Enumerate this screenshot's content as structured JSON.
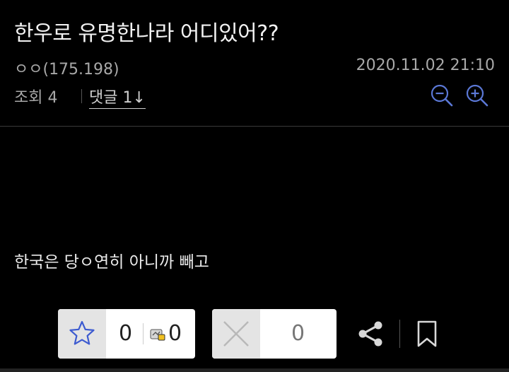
{
  "post": {
    "title": "한우로 유명한나라 어디있어??",
    "author": "ㅇㅇ(175.198)",
    "date": "2020.11.02 21:10",
    "views_label": "조회 4",
    "comments_label": "댓글 1↓",
    "body": "한국은 당ㅇ연히 아니까 빼고"
  },
  "actions": {
    "recommend_count": "0",
    "fixed_recommend_count": "0",
    "dislike_count": "0"
  },
  "icons": {
    "zoom_out": "zoom-out-icon",
    "zoom_in": "zoom-in-icon",
    "star": "star-icon",
    "fixed_recommend": "fixed-recommend-icon",
    "dislike": "x-icon",
    "share": "share-icon",
    "bookmark": "bookmark-icon"
  },
  "colors": {
    "background": "#000000",
    "accent_blue": "#5b78d6",
    "muted_text": "#a8a8a8"
  }
}
